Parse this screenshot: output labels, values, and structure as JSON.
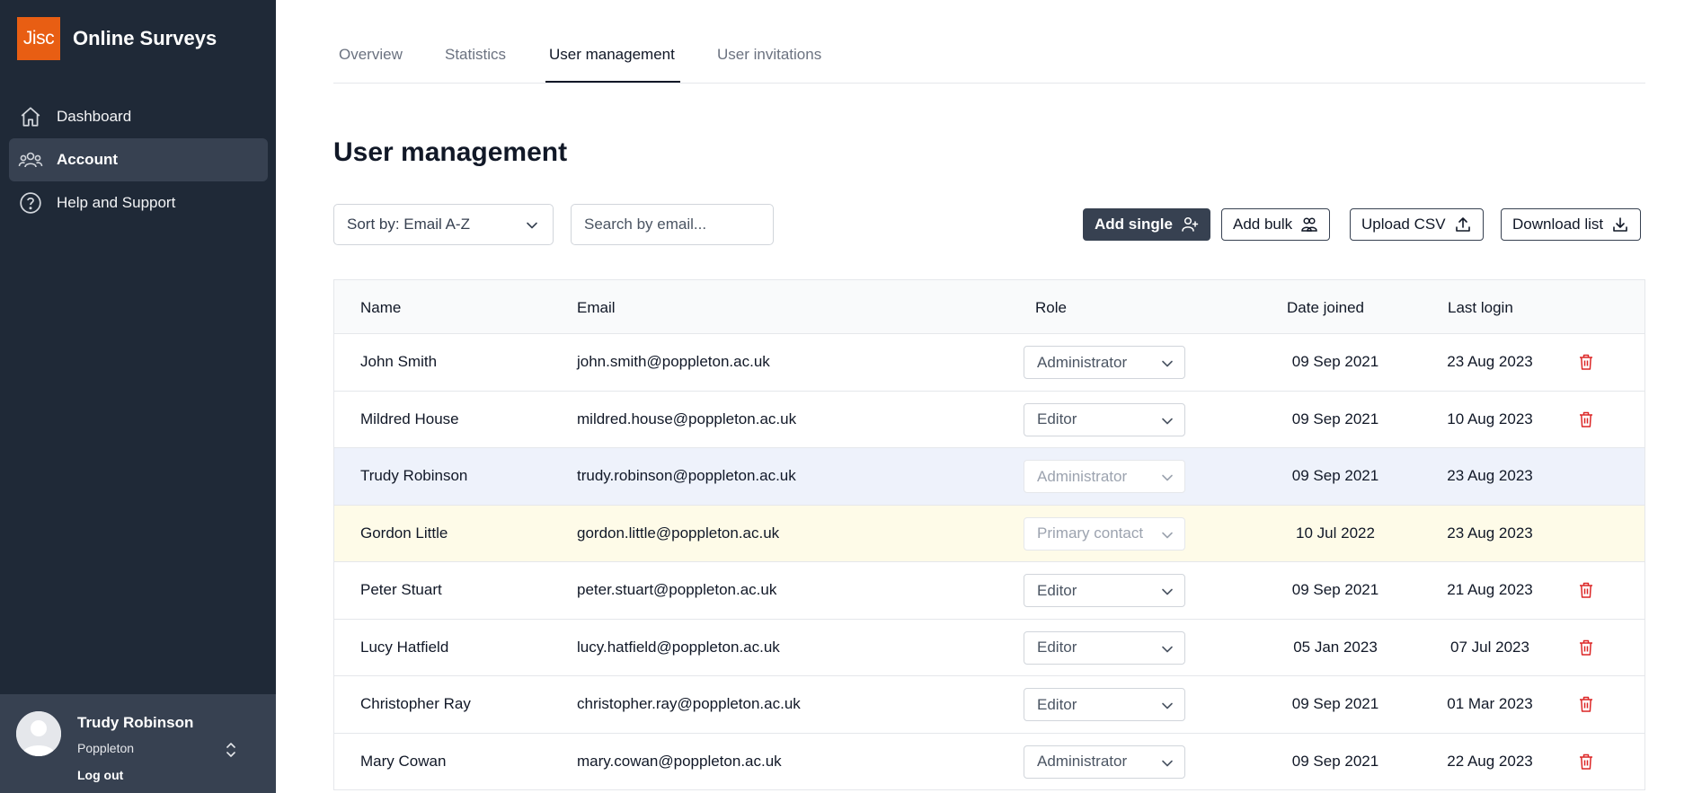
{
  "brand": {
    "logo_text": "Jisc",
    "app_name": "Online Surveys",
    "logo_color": "#e85e13"
  },
  "sidebar": {
    "items": [
      {
        "label": "Dashboard",
        "icon": "home-icon",
        "active": false
      },
      {
        "label": "Account",
        "icon": "users-icon",
        "active": true
      },
      {
        "label": "Help and Support",
        "icon": "question-circle-icon",
        "active": false
      }
    ]
  },
  "user": {
    "name": "Trudy Robinson",
    "org": "Poppleton",
    "logout_label": "Log out"
  },
  "tabs": [
    {
      "label": "Overview",
      "active": false
    },
    {
      "label": "Statistics",
      "active": false
    },
    {
      "label": "User management",
      "active": true
    },
    {
      "label": "User invitations",
      "active": false
    }
  ],
  "page": {
    "title": "User management"
  },
  "controls": {
    "sort_value": "Sort by: Email A-Z",
    "search_placeholder": "Search by email...",
    "add_single": "Add single",
    "add_bulk": "Add bulk",
    "upload_csv": "Upload CSV",
    "download_list": "Download list"
  },
  "table": {
    "headers": {
      "name": "Name",
      "email": "Email",
      "role": "Role",
      "joined": "Date joined",
      "login": "Last login"
    },
    "rows": [
      {
        "name": "John Smith",
        "email": "john.smith@poppleton.ac.uk",
        "role": "Administrator",
        "joined": "09 Sep 2021",
        "login": "23 Aug 2023",
        "state": "normal"
      },
      {
        "name": "Mildred House",
        "email": "mildred.house@poppleton.ac.uk",
        "role": "Editor",
        "joined": "09 Sep 2021",
        "login": "10 Aug 2023",
        "state": "normal"
      },
      {
        "name": "Trudy Robinson",
        "email": "trudy.robinson@poppleton.ac.uk",
        "role": "Administrator",
        "joined": "09 Sep 2021",
        "login": "23 Aug 2023",
        "state": "current"
      },
      {
        "name": "Gordon Little",
        "email": "gordon.little@poppleton.ac.uk",
        "role": "Primary contact",
        "joined": "10 Jul 2022",
        "login": "23 Aug 2023",
        "state": "primary"
      },
      {
        "name": "Peter Stuart",
        "email": "peter.stuart@poppleton.ac.uk",
        "role": "Editor",
        "joined": "09 Sep 2021",
        "login": "21 Aug 2023",
        "state": "normal"
      },
      {
        "name": "Lucy Hatfield",
        "email": "lucy.hatfield@poppleton.ac.uk",
        "role": "Editor",
        "joined": "05 Jan 2023",
        "login": "07 Jul 2023",
        "state": "normal"
      },
      {
        "name": "Christopher Ray",
        "email": "christopher.ray@poppleton.ac.uk",
        "role": "Editor",
        "joined": "09 Sep 2021",
        "login": "01 Mar 2023",
        "state": "normal"
      },
      {
        "name": "Mary Cowan",
        "email": "mary.cowan@poppleton.ac.uk",
        "role": "Administrator",
        "joined": "09 Sep 2021",
        "login": "22 Aug 2023",
        "state": "normal"
      }
    ]
  },
  "colors": {
    "sidebar_bg": "#1f2937",
    "delete_red": "#dc2626",
    "current_row": "#eef2fb",
    "primary_row": "#fefbe8"
  }
}
